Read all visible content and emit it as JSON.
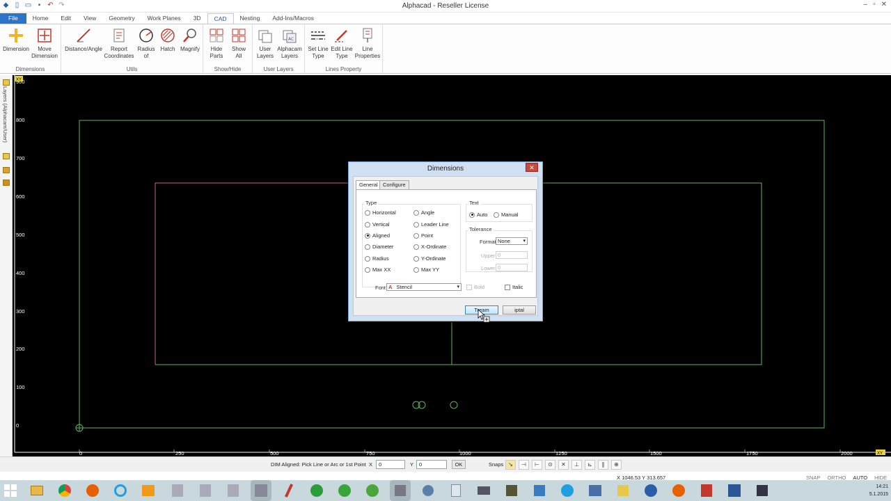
{
  "window": {
    "title": "Alphacad - Reseller License",
    "controls": [
      "–",
      "▫",
      "✕"
    ]
  },
  "tabs": [
    "File",
    "Home",
    "Edit",
    "View",
    "Geometry",
    "Work Planes",
    "3D",
    "CAD",
    "Nesting",
    "Add-Ins/Macros"
  ],
  "active_tab": "CAD",
  "ribbon": {
    "groups": [
      {
        "label": "Dimensions",
        "buttons": [
          [
            "Dimension",
            ""
          ],
          [
            "Move",
            "Dimension"
          ]
        ]
      },
      {
        "label": "Utils",
        "buttons": [
          [
            "Distance/Angle",
            ""
          ],
          [
            "Report",
            "Coordinates"
          ],
          [
            "Radius",
            "of"
          ],
          [
            "Hatch",
            ""
          ],
          [
            "Magnify",
            ""
          ]
        ]
      },
      {
        "label": "Show/Hide",
        "buttons": [
          [
            "Hide",
            "Parts"
          ],
          [
            "Show",
            "All"
          ]
        ]
      },
      {
        "label": "User Layers",
        "buttons": [
          [
            "User",
            "Layers"
          ],
          [
            "Alphacam",
            "Layers"
          ]
        ]
      },
      {
        "label": "Lines Property",
        "buttons": [
          [
            "Set Line",
            "Type"
          ],
          [
            "Edit Line",
            "Type"
          ],
          [
            "Line",
            "Properties"
          ]
        ]
      }
    ]
  },
  "leftbar": {
    "label": "Layers (Alphacam/User)"
  },
  "canvas": {
    "y_ticks": [
      "900",
      "800",
      "700",
      "600",
      "500",
      "400",
      "300",
      "200",
      "100",
      "0"
    ],
    "x_ticks": [
      "0",
      "250",
      "500",
      "750",
      "1000",
      "1250",
      "1500",
      "1750",
      "2000"
    ],
    "corner_labels": [
      "XY",
      "XY"
    ]
  },
  "dialog": {
    "title": "Dimensions",
    "close": "✕",
    "tabs": [
      "General",
      "Configure"
    ],
    "type_label": "Type",
    "types_col1": [
      "Horizontal",
      "Vertical",
      "Aligned",
      "Diameter",
      "Radius",
      "Max XX"
    ],
    "types_col2": [
      "Angle",
      "Leader Line",
      "Point",
      "X-Ordinate",
      "Y-Ordinate",
      "Max YY"
    ],
    "selected_type": "Aligned",
    "text_label": "Text",
    "text_options": [
      "Auto",
      "Manual"
    ],
    "selected_text": "Auto",
    "tolerance_label": "Tolerance",
    "format_label": "Format",
    "format_value": "None",
    "upper_label": "Upper",
    "upper_value": "0",
    "lower_label": "Lower",
    "lower_value": "0",
    "font_label": "Font",
    "font_value": "Stencil",
    "bold_label": "Bold",
    "italic_label": "Italic",
    "ok_label": "Tream",
    "cancel_label": "iptal"
  },
  "statusbar": {
    "prompt": "DIM Aligned: Pick Line or Arc or 1st Point",
    "x_label": "X",
    "x_value": "0",
    "y_label": "Y",
    "y_value": "0",
    "ok_label": "OK",
    "snaps_label": "Snaps",
    "coordinates": "X 1046.53   Y 313.657",
    "modes": [
      "SNAP",
      "ORTHO",
      "AUTO",
      "HIDE"
    ],
    "active_mode": "AUTO"
  },
  "taskbar": {
    "time": "14:21",
    "date": "5.1.2015"
  }
}
